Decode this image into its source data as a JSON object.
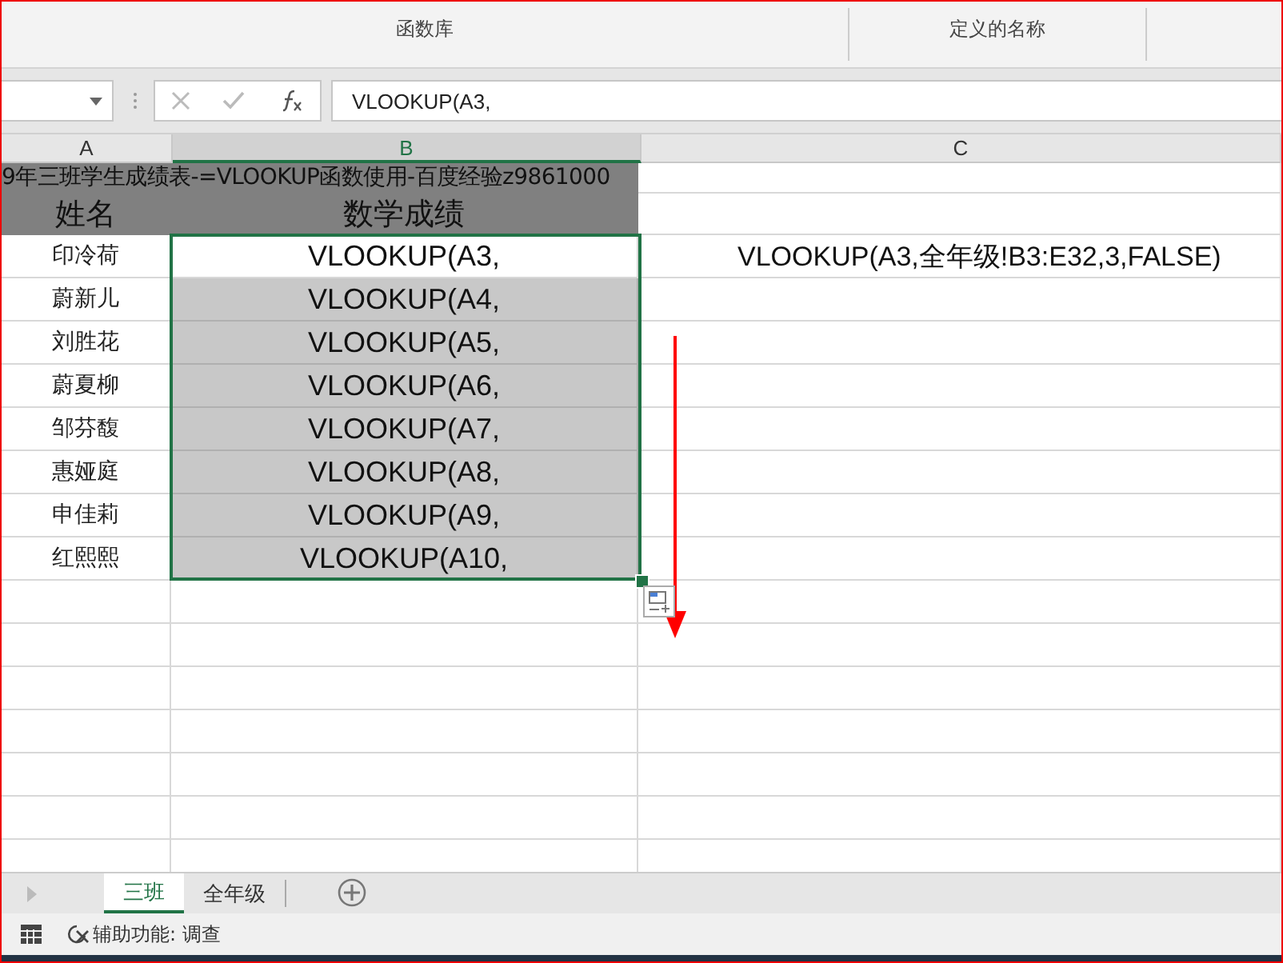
{
  "ribbon": {
    "groups": [
      {
        "label": "函数库"
      },
      {
        "label": "定义的名称"
      }
    ]
  },
  "formula_bar": {
    "value": "VLOOKUP(A3,"
  },
  "columns": [
    {
      "label": "A",
      "selected": false
    },
    {
      "label": "B",
      "selected": true
    },
    {
      "label": "C",
      "selected": false
    }
  ],
  "title_row": "9年三班学生成绩表-=VLOOKUP函数使用-百度经验z9861000",
  "header_row": [
    "姓名",
    "数学成绩"
  ],
  "rows": [
    {
      "name": "印冷荷",
      "value": "VLOOKUP(A3,",
      "selected": false,
      "overflow": "VLOOKUP(A3,全年级!B3:E32,3,FALSE)"
    },
    {
      "name": "蔚新儿",
      "value": "VLOOKUP(A4,",
      "selected": true
    },
    {
      "name": "刘胜花",
      "value": "VLOOKUP(A5,",
      "selected": true
    },
    {
      "name": "蔚夏柳",
      "value": "VLOOKUP(A6,",
      "selected": true
    },
    {
      "name": "邹芬馥",
      "value": "VLOOKUP(A7,",
      "selected": true
    },
    {
      "name": "惠娅庭",
      "value": "VLOOKUP(A8,",
      "selected": true
    },
    {
      "name": "申佳莉",
      "value": "VLOOKUP(A9,",
      "selected": true
    },
    {
      "name": "红熙熙",
      "value": "VLOOKUP(A10,",
      "selected": true
    }
  ],
  "sheet_tabs": [
    {
      "label": "三班",
      "selected": true
    },
    {
      "label": "全年级",
      "selected": false
    }
  ],
  "status_bar": {
    "accessibility": "辅助功能: 调查"
  }
}
